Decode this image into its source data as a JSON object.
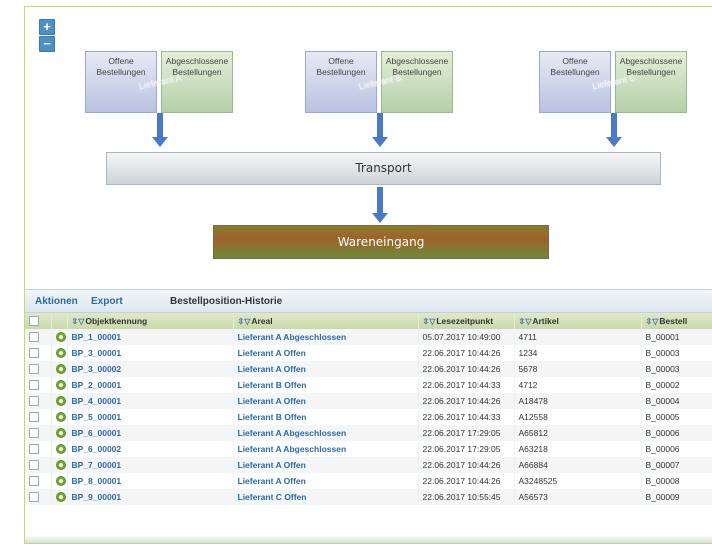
{
  "diagram": {
    "zoom_in": "+",
    "zoom_out": "−",
    "suppliers": [
      {
        "open": "Offene Bestellungen",
        "closed": "Abgeschlossene Bestellungen",
        "label": "Lieferant A"
      },
      {
        "open": "Offene Bestellungen",
        "closed": "Abgeschlossene Bestellungen",
        "label": "Lieferant B"
      },
      {
        "open": "Offene Bestellungen",
        "closed": "Abgeschlossene Bestellungen",
        "label": "Lieferant C"
      }
    ],
    "transport": "Transport",
    "wareneingang": "Wareneingang"
  },
  "toolbar": {
    "actions": "Aktionen",
    "export": "Export",
    "title": "Bestellposition-Historie"
  },
  "grid": {
    "columns": [
      "Objektkennung",
      "Areal",
      "Lesezeitpunkt",
      "Artikel",
      "Bestell"
    ],
    "rows": [
      [
        "BP_1_00001",
        "Lieferant A Abgeschlossen",
        "05.07.2017 10:49:00",
        "4711",
        "B_00001"
      ],
      [
        "BP_3_00001",
        "Lieferant A Offen",
        "22.06.2017 10:44:26",
        "1234",
        "B_00003"
      ],
      [
        "BP_3_00002",
        "Lieferant A Offen",
        "22.06.2017 10:44:26",
        "5678",
        "B_00003"
      ],
      [
        "BP_2_00001",
        "Lieferant B Offen",
        "22.06.2017 10:44:33",
        "4712",
        "B_00002"
      ],
      [
        "BP_4_00001",
        "Lieferant A Offen",
        "22.06.2017 10:44:26",
        "A18478",
        "B_00004"
      ],
      [
        "BP_5_00001",
        "Lieferant B Offen",
        "22.06.2017 10:44:33",
        "A12558",
        "B_00005"
      ],
      [
        "BP_6_00001",
        "Lieferant A Abgeschlossen",
        "22.06.2017 17:29:05",
        "A65812",
        "B_00006"
      ],
      [
        "BP_6_00002",
        "Lieferant A Abgeschlossen",
        "22.06.2017 17:29:05",
        "A63218",
        "B_00006"
      ],
      [
        "BP_7_00001",
        "Lieferant A Offen",
        "22.06.2017 10:44:26",
        "A66884",
        "B_00007"
      ],
      [
        "BP_8_00001",
        "Lieferant A Offen",
        "22.06.2017 10:44:26",
        "A3248525",
        "B_00008"
      ],
      [
        "BP_9_00001",
        "Lieferant C Offen",
        "22.06.2017 10:55:45",
        "A56573",
        "B_00009"
      ]
    ]
  }
}
